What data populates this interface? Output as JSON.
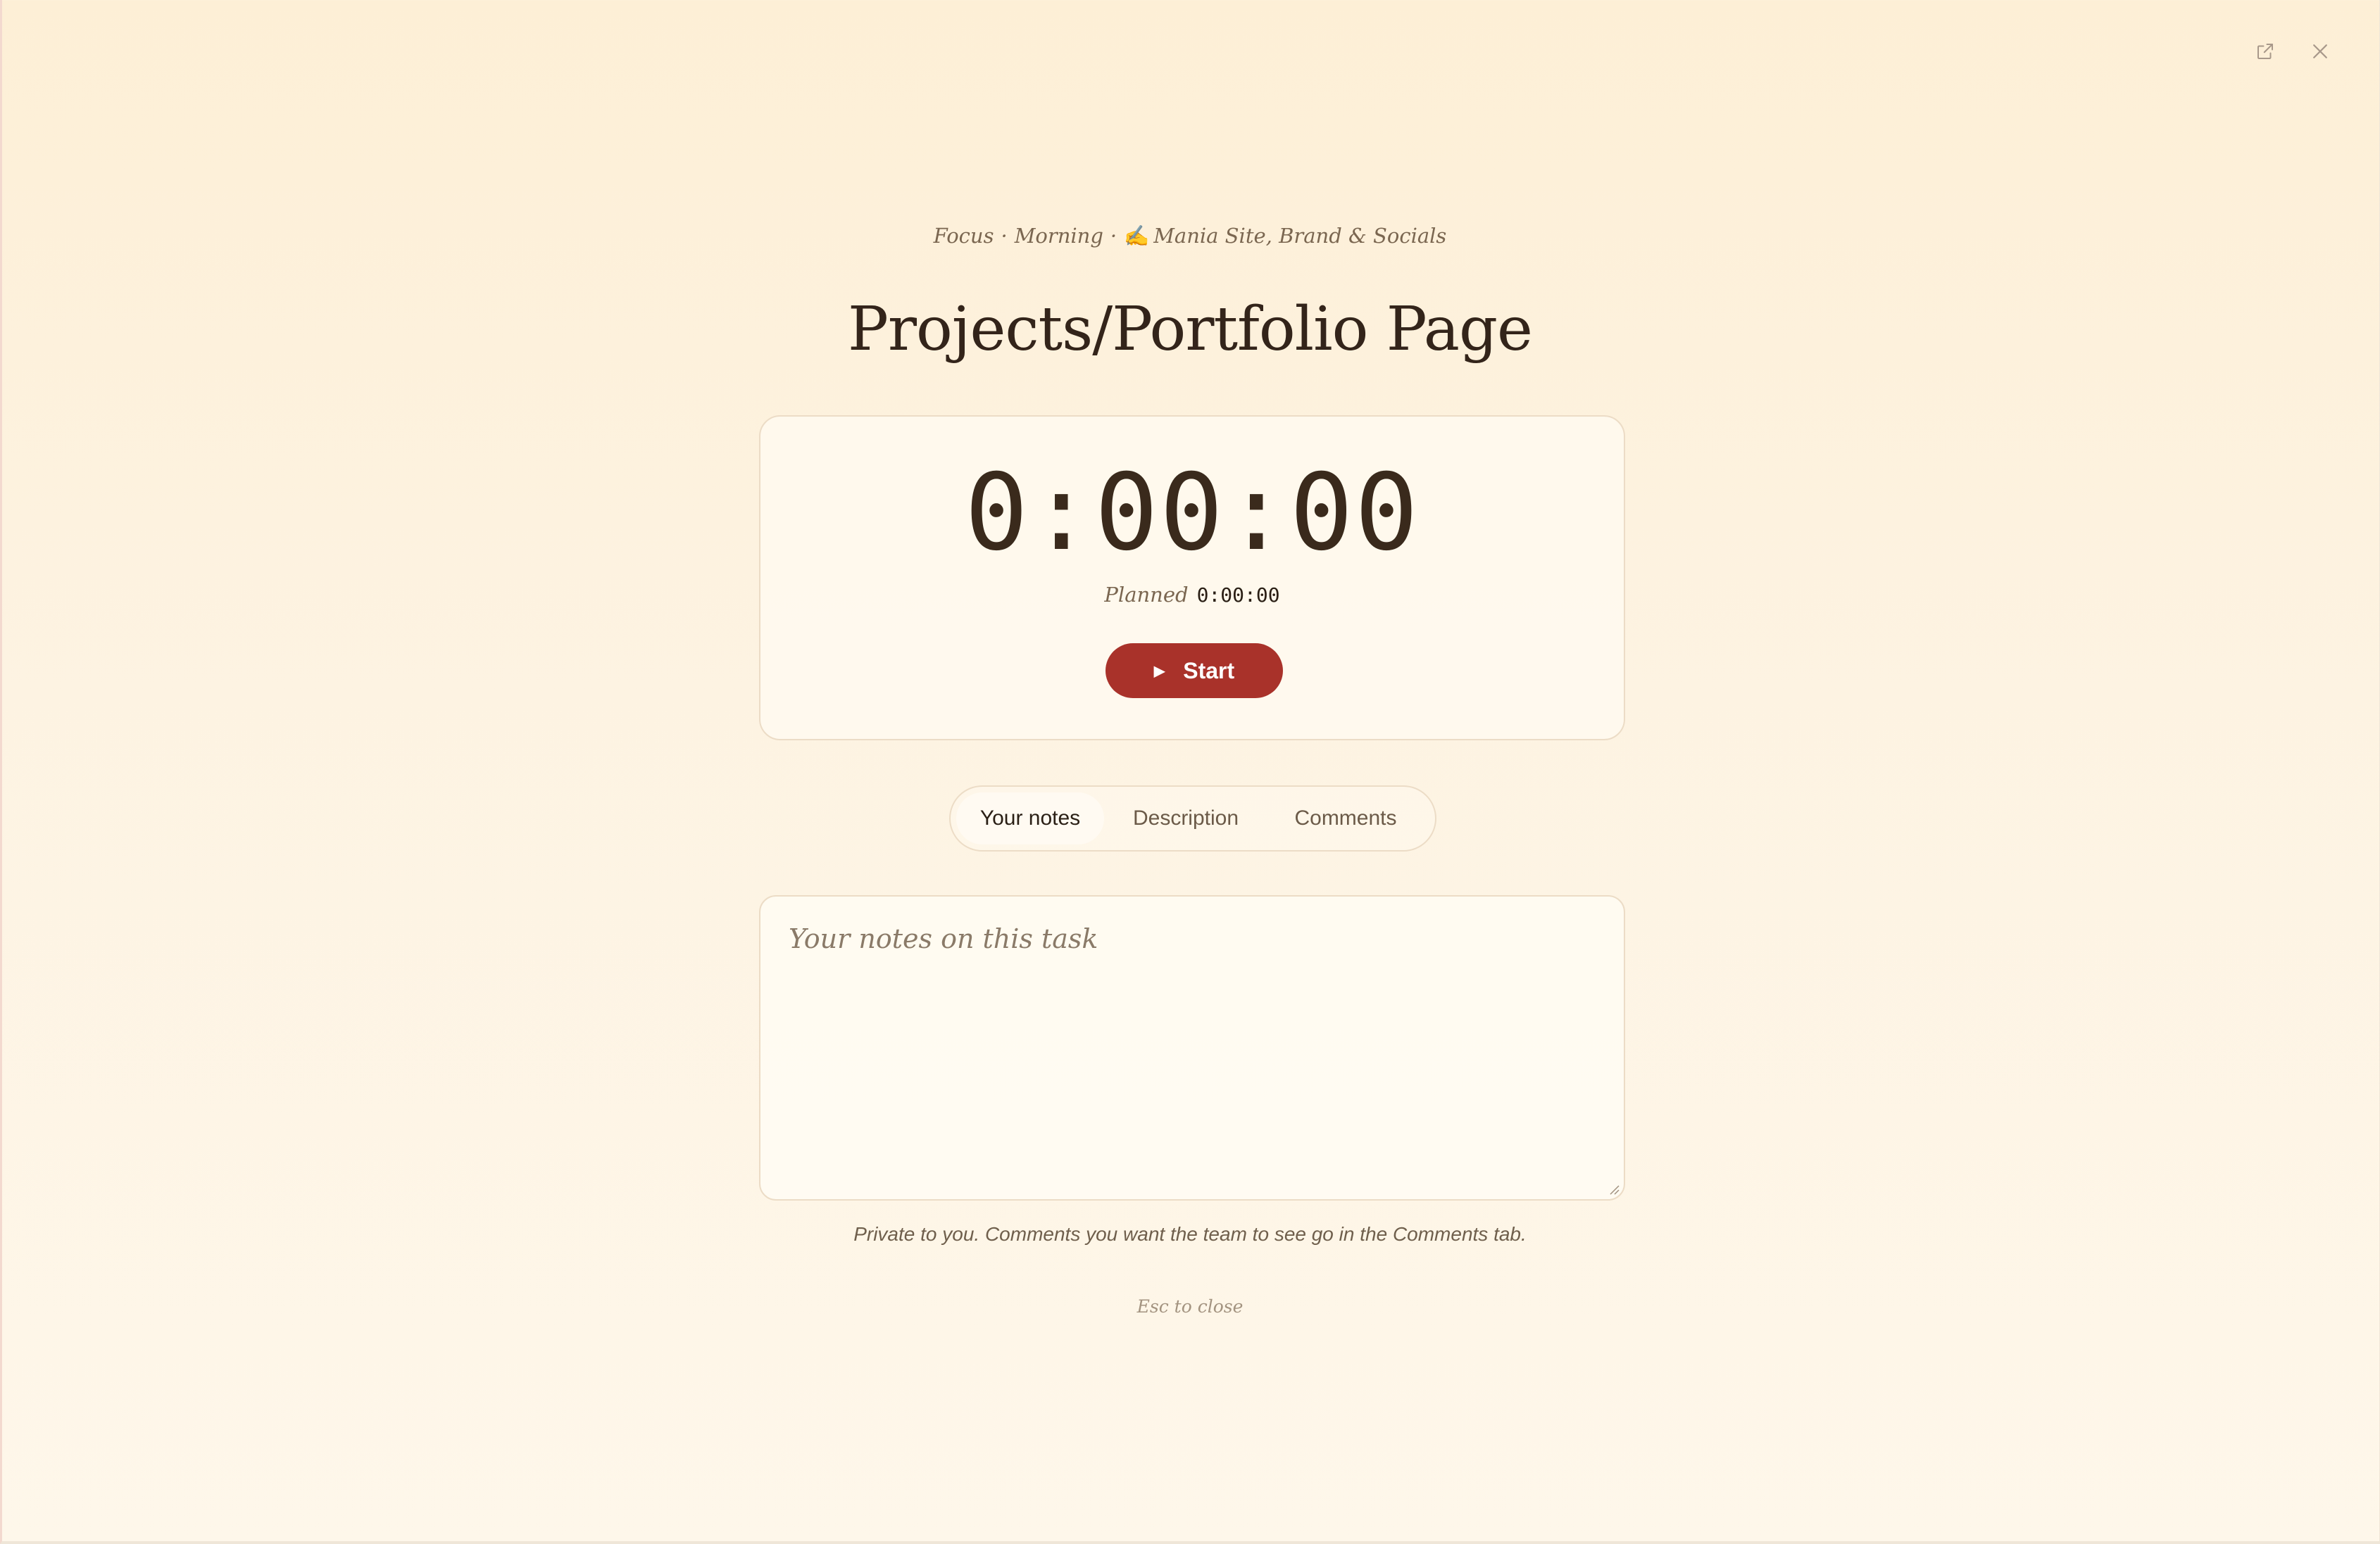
{
  "window": {
    "open_external_icon": "external-link-icon",
    "close_icon": "close-icon"
  },
  "context": {
    "mode": "Focus",
    "session": "Morning",
    "separator": "·",
    "project_emoji": "✍",
    "project": "Mania Site, Brand & Socials"
  },
  "task": {
    "title": "Projects/Portfolio Page"
  },
  "timer": {
    "elapsed": "0:00:00",
    "planned_label": "Planned",
    "planned_value": "0:00:00",
    "start_label": "Start",
    "start_icon": "play-icon"
  },
  "tabs": [
    {
      "label": "Your notes",
      "active": true
    },
    {
      "label": "Description",
      "active": false
    },
    {
      "label": "Comments",
      "active": false
    }
  ],
  "notes": {
    "value": "",
    "placeholder": "Your notes on this task"
  },
  "hint": "Private to you. Comments you want the team to see go in the Comments tab.",
  "esc_hint": "Esc to close",
  "colors": {
    "accent": "#a9322a",
    "background": "#fdf1dc",
    "text": "#3a2a1c"
  }
}
